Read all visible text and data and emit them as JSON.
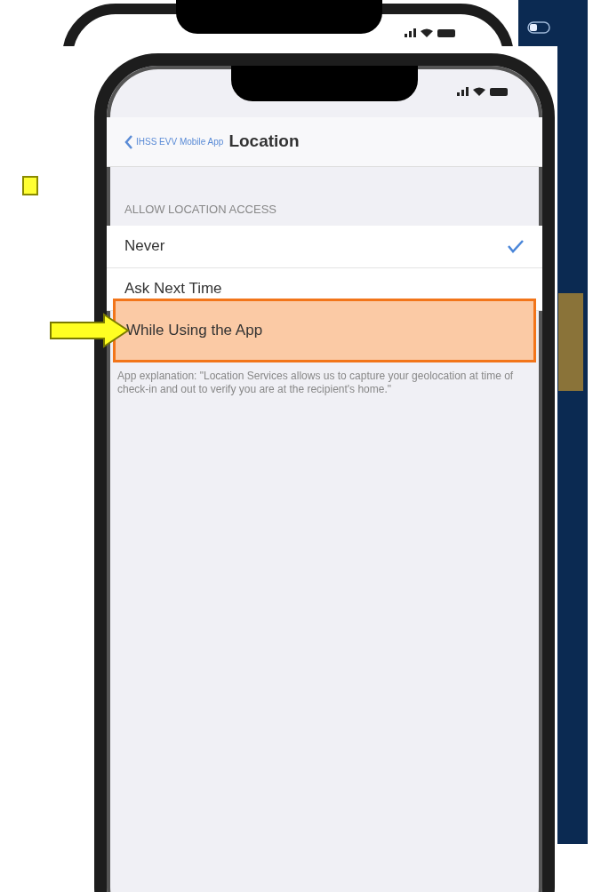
{
  "nav_bar": {
    "back_label": "IHSS EVV Mobile App",
    "title": "Location"
  },
  "section": {
    "header": "ALLOW LOCATION ACCESS",
    "options": [
      {
        "label": "Never",
        "checked": true,
        "highlighted": false
      },
      {
        "label": "Ask Next Time",
        "checked": false,
        "highlighted": false
      },
      {
        "label": "While Using the App",
        "checked": false,
        "highlighted": true
      }
    ],
    "footer": "App explanation: \"Location Services allows us to capture your geolocation at time of check-in and out to verify you are at the recipient's home.\""
  }
}
